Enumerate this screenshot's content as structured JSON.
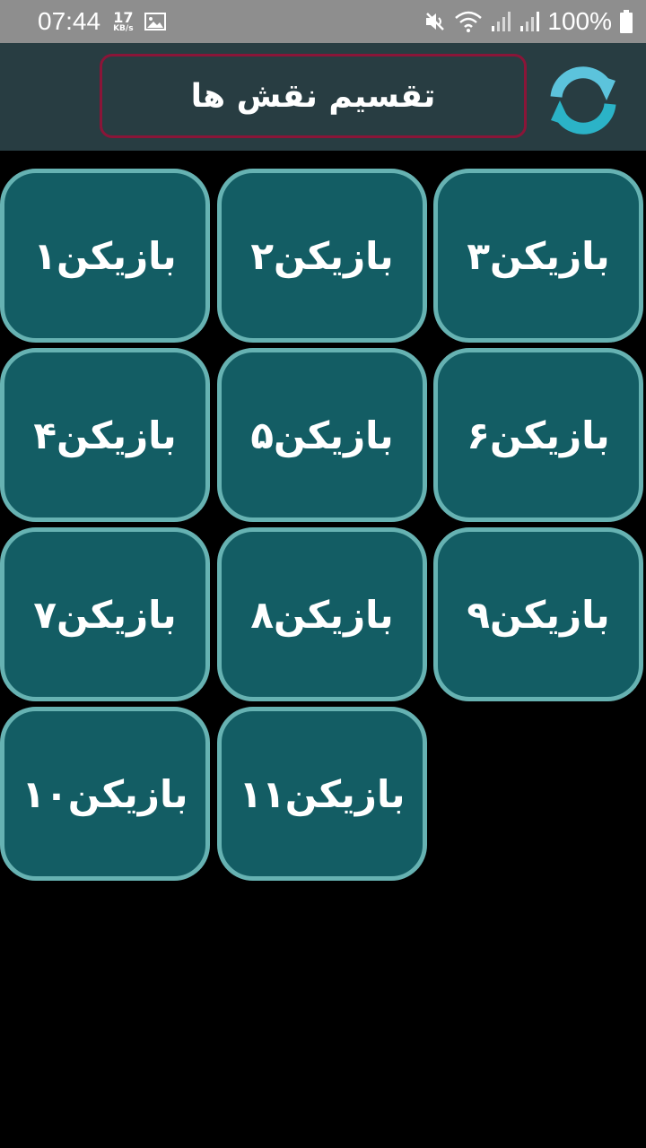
{
  "status_bar": {
    "time": "07:44",
    "speed_value": "17",
    "speed_unit": "KB/s",
    "battery": "100%",
    "icons": [
      "image-icon",
      "mute-icon",
      "wifi-icon",
      "signal-icon",
      "signal-icon",
      "battery-icon"
    ]
  },
  "toolbar": {
    "title": "تقسیم نقش ها",
    "refresh_icon": "refresh-icon"
  },
  "players": [
    "بازیکن۱",
    "بازیکن۲",
    "بازیکن۳",
    "بازیکن۴",
    "بازیکن۵",
    "بازیکن۶",
    "بازیکن۷",
    "بازیکن۸",
    "بازیکن۹",
    "بازیکن۱۰",
    "بازیکن۱۱"
  ],
  "colors": {
    "toolbar_bg": "#283d42",
    "title_border": "#8a1538",
    "tile_bg": "#135d64",
    "tile_border": "#66b2b2",
    "background": "#000000"
  }
}
